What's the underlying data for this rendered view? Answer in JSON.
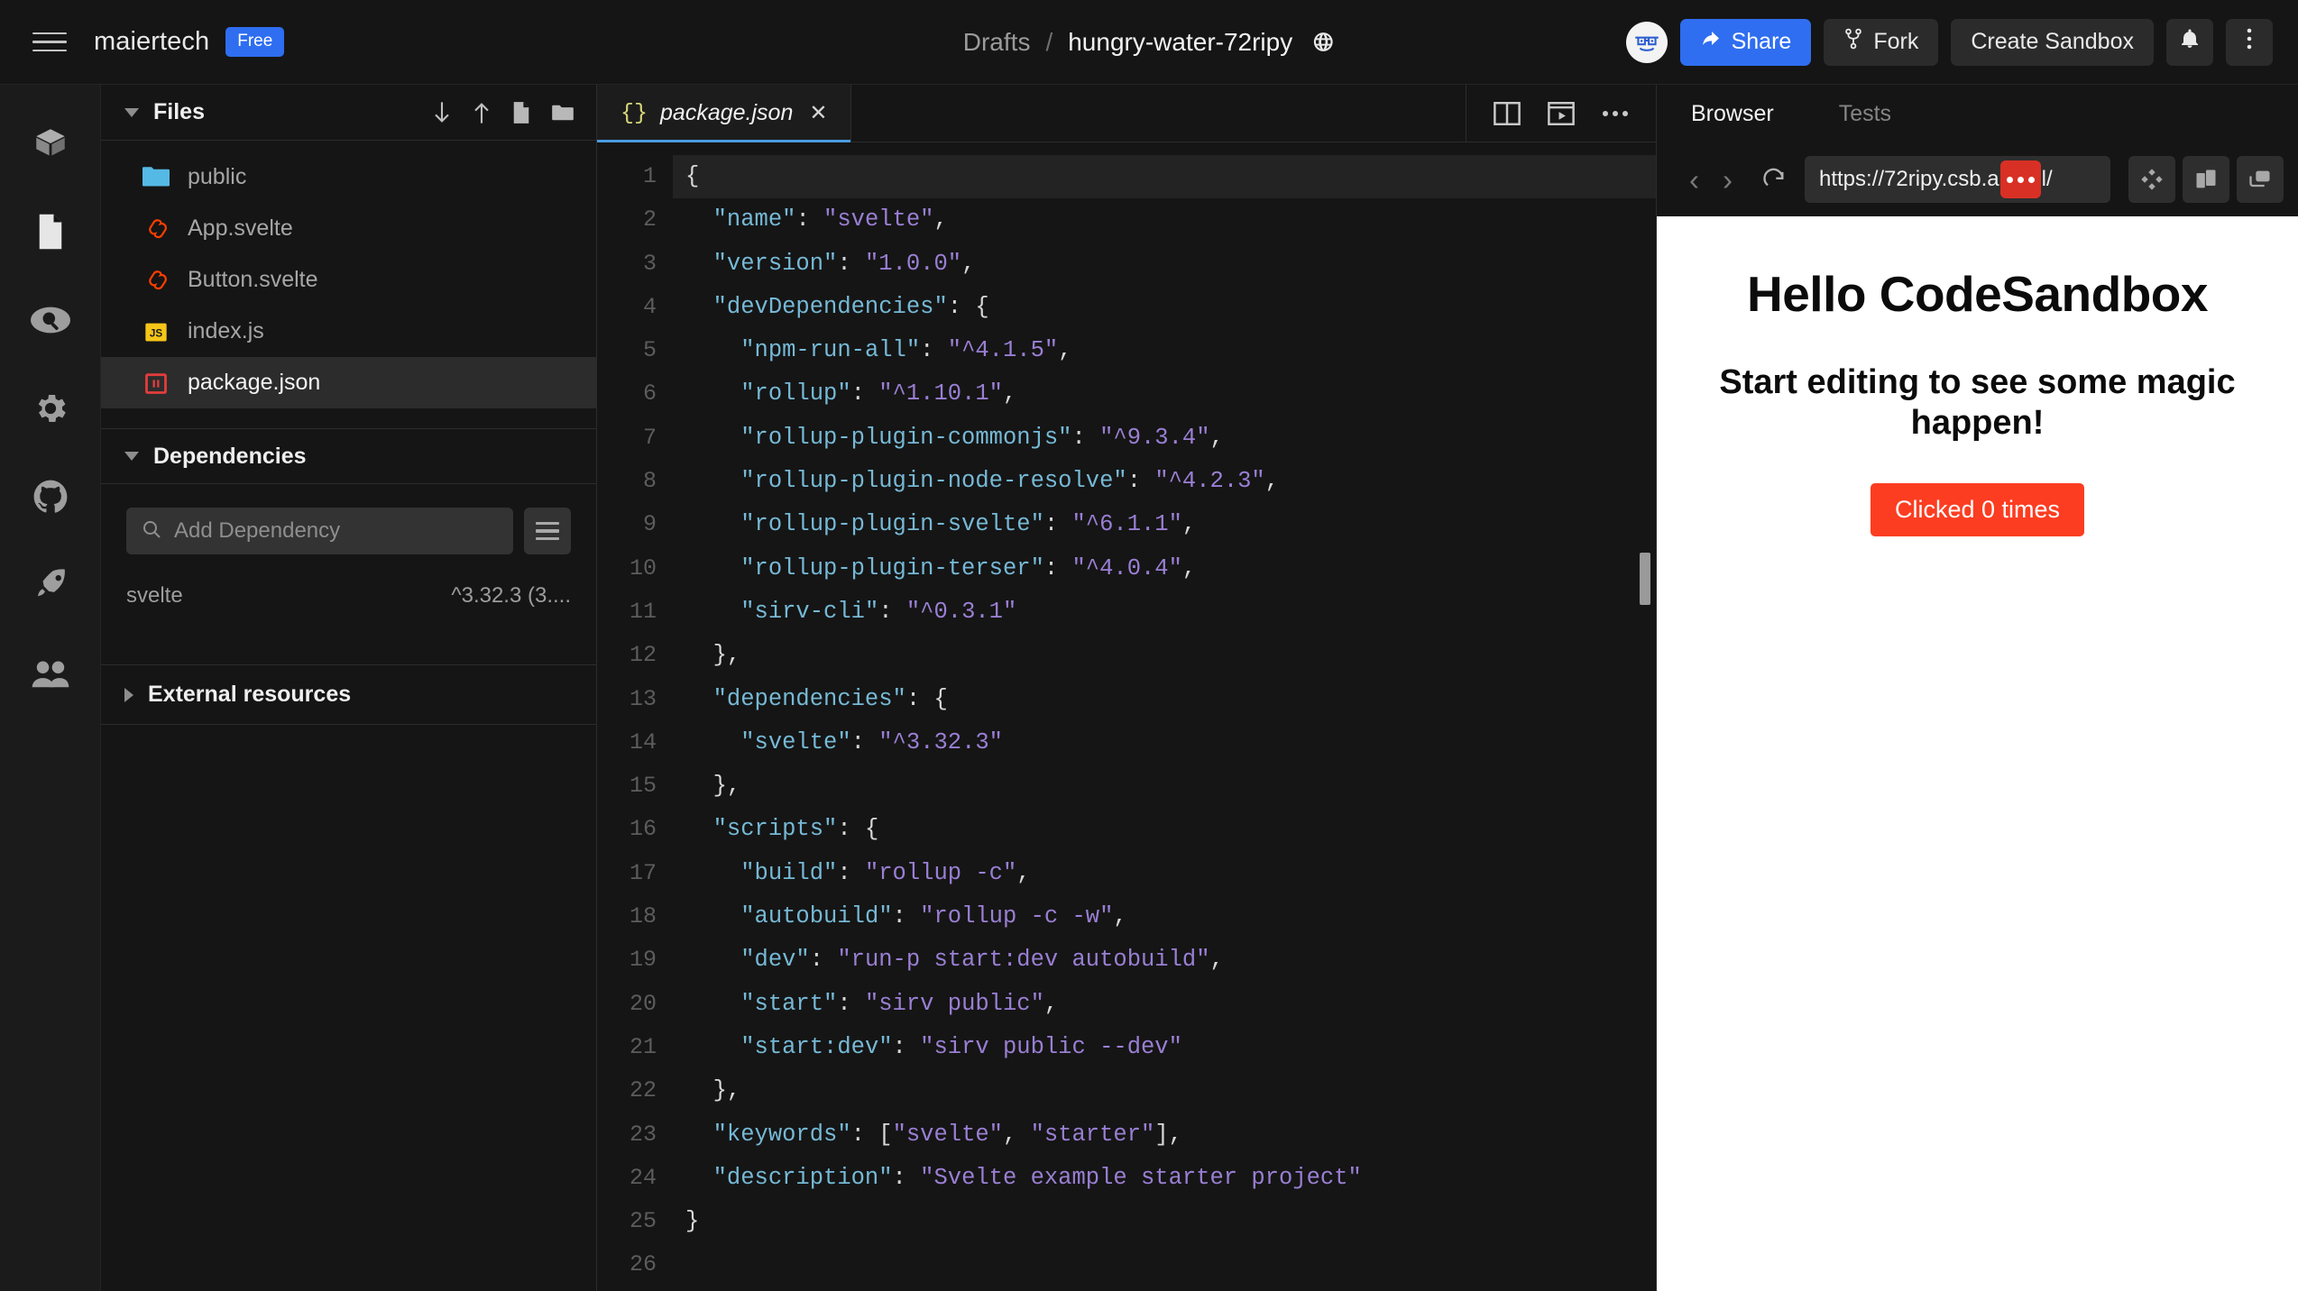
{
  "header": {
    "menu_icon": "hamburger-icon",
    "team_name": "maiertech",
    "plan_badge": "Free",
    "breadcrumb": {
      "parent": "Drafts",
      "separator": "/",
      "title": "hungry-water-72ripy",
      "visibility_icon": "globe-icon"
    },
    "avatar_icon": "user-avatar",
    "share_label": "Share",
    "fork_label": "Fork",
    "create_sandbox_label": "Create Sandbox",
    "notifications_icon": "bell-icon",
    "overflow_icon": "more-vertical-icon",
    "accent_color": "#2f6ef0"
  },
  "rail": {
    "items": [
      {
        "icon": "cube-icon",
        "name": "explorer"
      },
      {
        "icon": "file-icon",
        "name": "files"
      },
      {
        "icon": "search-icon",
        "name": "search"
      },
      {
        "icon": "gear-icon",
        "name": "settings"
      },
      {
        "icon": "github-icon",
        "name": "github"
      },
      {
        "icon": "rocket-icon",
        "name": "deploy"
      },
      {
        "icon": "people-icon",
        "name": "live"
      }
    ]
  },
  "sidebar": {
    "files_panel": {
      "title": "Files",
      "collapsed": false,
      "actions": [
        {
          "icon": "arrow-down-icon",
          "name": "download"
        },
        {
          "icon": "arrow-up-icon",
          "name": "upload"
        },
        {
          "icon": "new-file-icon",
          "name": "new-file"
        },
        {
          "icon": "new-folder-icon",
          "name": "new-folder"
        }
      ],
      "files": [
        {
          "name": "public",
          "icon": "folder-icon",
          "selected": false
        },
        {
          "name": "App.svelte",
          "icon": "svelte-icon",
          "selected": false
        },
        {
          "name": "Button.svelte",
          "icon": "svelte-icon",
          "selected": false
        },
        {
          "name": "index.js",
          "icon": "js-icon",
          "selected": false
        },
        {
          "name": "package.json",
          "icon": "json-icon",
          "selected": true
        }
      ]
    },
    "dependencies_panel": {
      "title": "Dependencies",
      "collapsed": false,
      "search_placeholder": "Add Dependency",
      "search_value": "",
      "search_icon": "search-icon",
      "menu_icon": "list-menu-icon",
      "items": [
        {
          "name": "svelte",
          "version": "^3.32.3 (3...."
        }
      ]
    },
    "external_resources_panel": {
      "title": "External resources",
      "collapsed": true
    }
  },
  "editor": {
    "tabs": [
      {
        "label": "package.json",
        "icon": "json-braces-icon",
        "active": true,
        "close_icon": "close-icon"
      }
    ],
    "actions": [
      {
        "icon": "split-pane-icon",
        "name": "split-view"
      },
      {
        "icon": "preview-window-icon",
        "name": "toggle-preview"
      },
      {
        "icon": "more-horizontal-icon",
        "name": "editor-options"
      }
    ],
    "active_line": 1,
    "total_lines": 26,
    "lines": [
      {
        "n": 1,
        "tokens": [
          {
            "t": "punc",
            "v": "{"
          }
        ]
      },
      {
        "n": 2,
        "tokens": [
          {
            "t": "punc",
            "v": "  "
          },
          {
            "t": "key",
            "v": "\"name\""
          },
          {
            "t": "punc",
            "v": ": "
          },
          {
            "t": "str",
            "v": "\"svelte\""
          },
          {
            "t": "punc",
            "v": ","
          }
        ]
      },
      {
        "n": 3,
        "tokens": [
          {
            "t": "punc",
            "v": "  "
          },
          {
            "t": "key",
            "v": "\"version\""
          },
          {
            "t": "punc",
            "v": ": "
          },
          {
            "t": "str",
            "v": "\"1.0.0\""
          },
          {
            "t": "punc",
            "v": ","
          }
        ]
      },
      {
        "n": 4,
        "tokens": [
          {
            "t": "punc",
            "v": "  "
          },
          {
            "t": "key",
            "v": "\"devDependencies\""
          },
          {
            "t": "punc",
            "v": ": {"
          }
        ]
      },
      {
        "n": 5,
        "tokens": [
          {
            "t": "punc",
            "v": "    "
          },
          {
            "t": "key",
            "v": "\"npm-run-all\""
          },
          {
            "t": "punc",
            "v": ": "
          },
          {
            "t": "str",
            "v": "\"^4.1.5\""
          },
          {
            "t": "punc",
            "v": ","
          }
        ]
      },
      {
        "n": 6,
        "tokens": [
          {
            "t": "punc",
            "v": "    "
          },
          {
            "t": "key",
            "v": "\"rollup\""
          },
          {
            "t": "punc",
            "v": ": "
          },
          {
            "t": "str",
            "v": "\"^1.10.1\""
          },
          {
            "t": "punc",
            "v": ","
          }
        ]
      },
      {
        "n": 7,
        "tokens": [
          {
            "t": "punc",
            "v": "    "
          },
          {
            "t": "key",
            "v": "\"rollup-plugin-commonjs\""
          },
          {
            "t": "punc",
            "v": ": "
          },
          {
            "t": "str",
            "v": "\"^9.3.4\""
          },
          {
            "t": "punc",
            "v": ","
          }
        ]
      },
      {
        "n": 8,
        "tokens": [
          {
            "t": "punc",
            "v": "    "
          },
          {
            "t": "key",
            "v": "\"rollup-plugin-node-resolve\""
          },
          {
            "t": "punc",
            "v": ": "
          },
          {
            "t": "str",
            "v": "\"^4.2.3\""
          },
          {
            "t": "punc",
            "v": ","
          }
        ]
      },
      {
        "n": 9,
        "tokens": [
          {
            "t": "punc",
            "v": "    "
          },
          {
            "t": "key",
            "v": "\"rollup-plugin-svelte\""
          },
          {
            "t": "punc",
            "v": ": "
          },
          {
            "t": "str",
            "v": "\"^6.1.1\""
          },
          {
            "t": "punc",
            "v": ","
          }
        ]
      },
      {
        "n": 10,
        "tokens": [
          {
            "t": "punc",
            "v": "    "
          },
          {
            "t": "key",
            "v": "\"rollup-plugin-terser\""
          },
          {
            "t": "punc",
            "v": ": "
          },
          {
            "t": "str",
            "v": "\"^4.0.4\""
          },
          {
            "t": "punc",
            "v": ","
          }
        ]
      },
      {
        "n": 11,
        "tokens": [
          {
            "t": "punc",
            "v": "    "
          },
          {
            "t": "key",
            "v": "\"sirv-cli\""
          },
          {
            "t": "punc",
            "v": ": "
          },
          {
            "t": "str",
            "v": "\"^0.3.1\""
          }
        ]
      },
      {
        "n": 12,
        "tokens": [
          {
            "t": "punc",
            "v": "  },"
          }
        ]
      },
      {
        "n": 13,
        "tokens": [
          {
            "t": "punc",
            "v": "  "
          },
          {
            "t": "key",
            "v": "\"dependencies\""
          },
          {
            "t": "punc",
            "v": ": {"
          }
        ]
      },
      {
        "n": 14,
        "tokens": [
          {
            "t": "punc",
            "v": "    "
          },
          {
            "t": "key",
            "v": "\"svelte\""
          },
          {
            "t": "punc",
            "v": ": "
          },
          {
            "t": "str",
            "v": "\"^3.32.3\""
          }
        ]
      },
      {
        "n": 15,
        "tokens": [
          {
            "t": "punc",
            "v": "  },"
          }
        ]
      },
      {
        "n": 16,
        "tokens": [
          {
            "t": "punc",
            "v": "  "
          },
          {
            "t": "key",
            "v": "\"scripts\""
          },
          {
            "t": "punc",
            "v": ": {"
          }
        ]
      },
      {
        "n": 17,
        "tokens": [
          {
            "t": "punc",
            "v": "    "
          },
          {
            "t": "key",
            "v": "\"build\""
          },
          {
            "t": "punc",
            "v": ": "
          },
          {
            "t": "str",
            "v": "\"rollup -c\""
          },
          {
            "t": "punc",
            "v": ","
          }
        ]
      },
      {
        "n": 18,
        "tokens": [
          {
            "t": "punc",
            "v": "    "
          },
          {
            "t": "key",
            "v": "\"autobuild\""
          },
          {
            "t": "punc",
            "v": ": "
          },
          {
            "t": "str",
            "v": "\"rollup -c -w\""
          },
          {
            "t": "punc",
            "v": ","
          }
        ]
      },
      {
        "n": 19,
        "tokens": [
          {
            "t": "punc",
            "v": "    "
          },
          {
            "t": "key",
            "v": "\"dev\""
          },
          {
            "t": "punc",
            "v": ": "
          },
          {
            "t": "str",
            "v": "\"run-p start:dev autobuild\""
          },
          {
            "t": "punc",
            "v": ","
          }
        ]
      },
      {
        "n": 20,
        "tokens": [
          {
            "t": "punc",
            "v": "    "
          },
          {
            "t": "key",
            "v": "\"start\""
          },
          {
            "t": "punc",
            "v": ": "
          },
          {
            "t": "str",
            "v": "\"sirv public\""
          },
          {
            "t": "punc",
            "v": ","
          }
        ]
      },
      {
        "n": 21,
        "tokens": [
          {
            "t": "punc",
            "v": "    "
          },
          {
            "t": "key",
            "v": "\"start:dev\""
          },
          {
            "t": "punc",
            "v": ": "
          },
          {
            "t": "str",
            "v": "\"sirv public --dev\""
          }
        ]
      },
      {
        "n": 22,
        "tokens": [
          {
            "t": "punc",
            "v": "  },"
          }
        ]
      },
      {
        "n": 23,
        "tokens": [
          {
            "t": "punc",
            "v": "  "
          },
          {
            "t": "key",
            "v": "\"keywords\""
          },
          {
            "t": "punc",
            "v": ": ["
          },
          {
            "t": "str",
            "v": "\"svelte\""
          },
          {
            "t": "punc",
            "v": ", "
          },
          {
            "t": "str",
            "v": "\"starter\""
          },
          {
            "t": "punc",
            "v": "],"
          }
        ]
      },
      {
        "n": 24,
        "tokens": [
          {
            "t": "punc",
            "v": "  "
          },
          {
            "t": "key",
            "v": "\"description\""
          },
          {
            "t": "punc",
            "v": ": "
          },
          {
            "t": "str",
            "v": "\"Svelte example starter project\""
          }
        ]
      },
      {
        "n": 25,
        "tokens": [
          {
            "t": "punc",
            "v": "}"
          }
        ]
      },
      {
        "n": 26,
        "tokens": []
      }
    ]
  },
  "preview": {
    "tabs": [
      {
        "label": "Browser",
        "active": true
      },
      {
        "label": "Tests",
        "active": false
      }
    ],
    "back_icon": "chevron-left-icon",
    "forward_icon": "chevron-right-icon",
    "reload_icon": "reload-icon",
    "url_prefix": "https://72ripy.csb.a",
    "url_suffix": "l/",
    "url_redacted_dots": 3,
    "redaction_color": "#d93025",
    "actions": [
      {
        "icon": "responsive-grid-icon",
        "name": "responsive-mode"
      },
      {
        "icon": "new-window-icon",
        "name": "open-in-new-window"
      },
      {
        "icon": "copy-window-icon",
        "name": "pop-out"
      }
    ],
    "page": {
      "heading": "Hello CodeSandbox",
      "subheading": "Start editing to see some magic happen!",
      "button_label": "Clicked 0 times",
      "button_color": "#fc3d21"
    }
  }
}
